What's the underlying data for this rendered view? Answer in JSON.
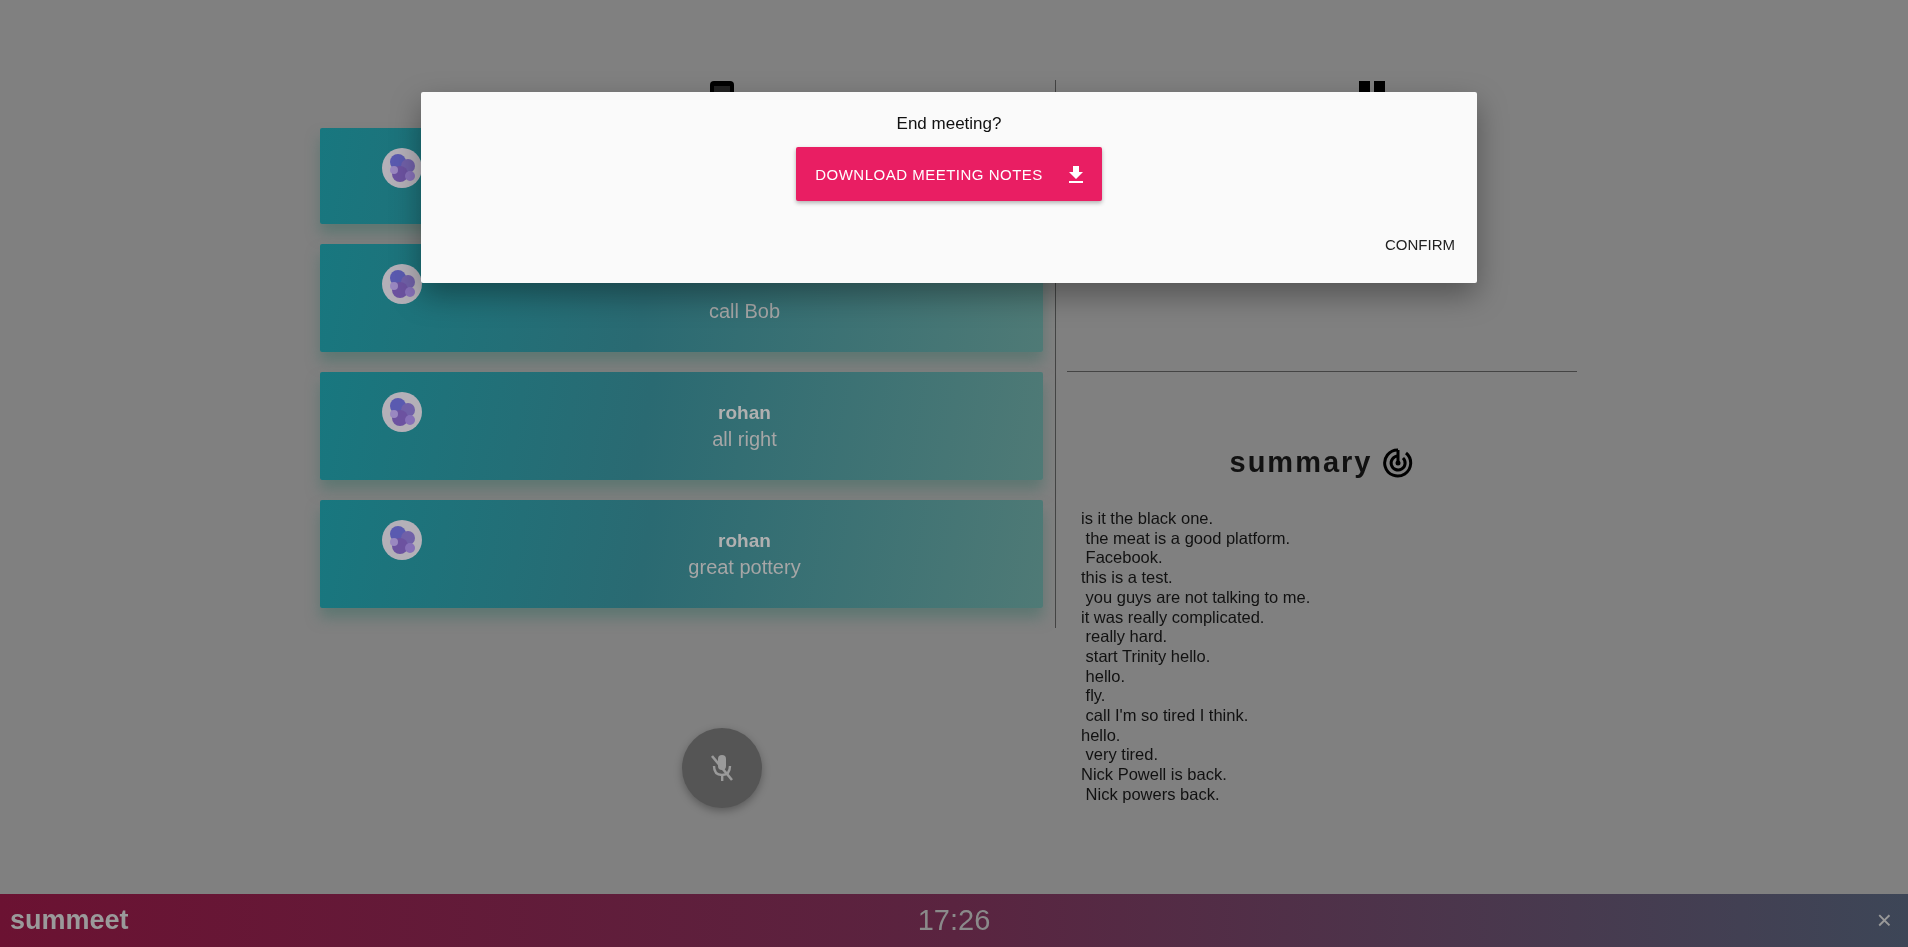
{
  "conversation": {
    "messages": [
      {
        "kind": "avatar_only"
      },
      {
        "kind": "message",
        "text": "call Bob"
      },
      {
        "kind": "message",
        "name": "rohan",
        "text": "all right"
      },
      {
        "kind": "message",
        "name": "rohan",
        "text": "great pottery"
      }
    ]
  },
  "mic_button": {
    "muted": true
  },
  "summary": {
    "title": "summary",
    "lines": [
      "is it the black one.",
      " the meat is a good platform.",
      " Facebook.",
      "this is a test.",
      " you guys are not talking to me.",
      "it was really complicated.",
      " really hard.",
      " start Trinity hello.",
      " hello.",
      " fly.",
      " call I'm so tired I think.",
      "hello.",
      " very tired.",
      "Nick Powell is back.",
      " Nick powers back."
    ]
  },
  "dialog": {
    "title": "End meeting?",
    "download_button": "DOWNLOAD MEETING NOTES",
    "confirm_button": "CONFIRM"
  },
  "bottom_bar": {
    "brand": "summeet",
    "time": "17:26",
    "close": "×"
  }
}
